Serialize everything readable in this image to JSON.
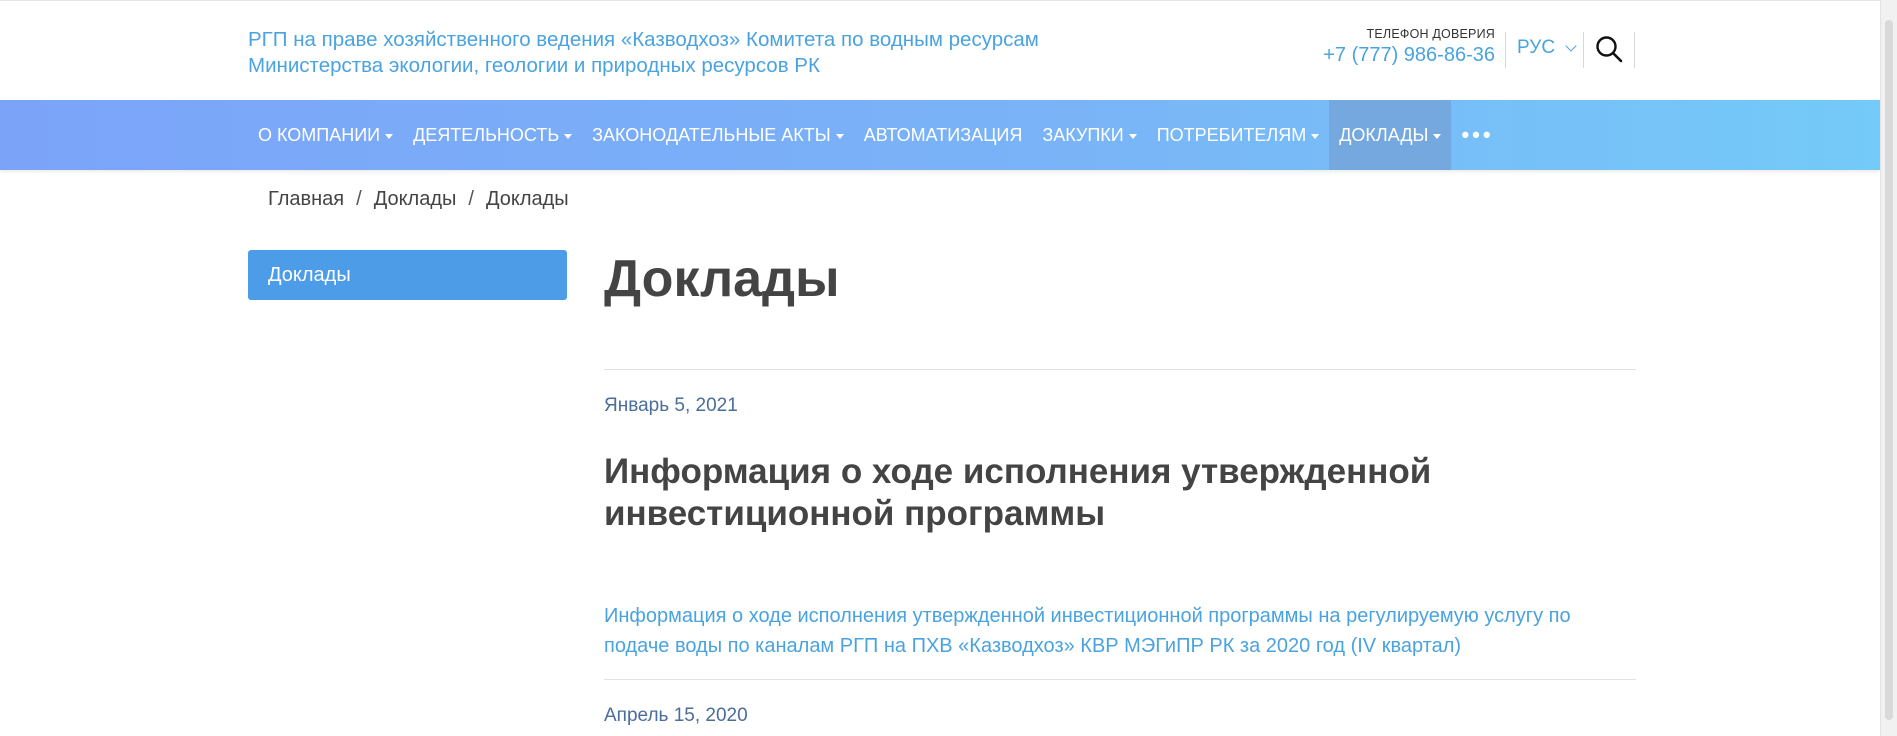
{
  "header": {
    "org_line1": "РГП на праве хозяйственного ведения «Казводхоз» Комитета по водным ресурсам",
    "org_line2": "Министерства экологии, геологии и природных ресурсов РК",
    "hotline_label": "ТЕЛЕФОН ДОВЕРИЯ",
    "hotline_phone": "+7 (777) 986-86-36",
    "language": "РУС",
    "search_icon": "search-icon"
  },
  "nav": {
    "items": [
      {
        "label": "О КОМПАНИИ",
        "dropdown": true
      },
      {
        "label": "ДЕЯТЕЛЬНОСТЬ",
        "dropdown": true
      },
      {
        "label": "ЗАКОНОДАТЕЛЬНЫЕ АКТЫ",
        "dropdown": true
      },
      {
        "label": "АВТОМАТИЗАЦИЯ",
        "dropdown": false
      },
      {
        "label": "ЗАКУПКИ",
        "dropdown": true
      },
      {
        "label": "ПОТРЕБИТЕЛЯМ",
        "dropdown": true
      },
      {
        "label": "ДОКЛАДЫ",
        "dropdown": true,
        "active": true
      }
    ],
    "more": "•••"
  },
  "breadcrumb": {
    "items": [
      "Главная",
      "Доклады",
      "Доклады"
    ],
    "separator": "/"
  },
  "sidebar": {
    "items": [
      {
        "label": "Доклады",
        "active": true
      }
    ]
  },
  "main": {
    "title": "Доклады",
    "posts": [
      {
        "date": "Январь 5, 2021",
        "title": "Информация о ходе исполнения утвержденной инвестиционной программы",
        "link": "Информация о ходе исполнения утвержденной инвестиционной программы на регулируемую услугу по подаче воды по каналам РГП на ПХВ «Казводхоз» КВР МЭГиПР РК за 2020 год (IV квартал)"
      },
      {
        "date": "Апрель 15, 2020"
      }
    ]
  },
  "colors": {
    "accent": "#4aa3df",
    "nav_start": "#7ba4f9",
    "nav_end": "#74caf8",
    "nav_active": "#74a8de",
    "sidebar_active": "#4d9ce8"
  }
}
